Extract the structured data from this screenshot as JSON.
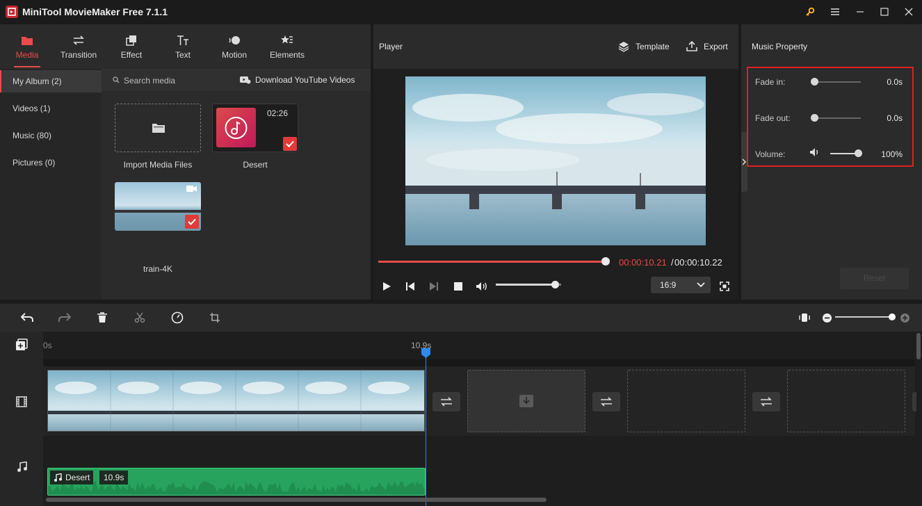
{
  "app": {
    "title": "MiniTool MovieMaker Free 7.1.1"
  },
  "toolbar": {
    "tabs": [
      {
        "label": "Media",
        "icon": "folder-icon",
        "active": true
      },
      {
        "label": "Transition",
        "icon": "swap-arrows-icon"
      },
      {
        "label": "Effect",
        "icon": "effect-icon"
      },
      {
        "label": "Text",
        "icon": "text-icon"
      },
      {
        "label": "Motion",
        "icon": "motion-icon"
      },
      {
        "label": "Elements",
        "icon": "elements-icon"
      }
    ]
  },
  "sidebar": {
    "items": [
      {
        "label": "My Album (2)",
        "active": true
      },
      {
        "label": "Videos (1)"
      },
      {
        "label": "Music (80)"
      },
      {
        "label": "Pictures (0)"
      }
    ]
  },
  "media": {
    "search_placeholder": "Search media",
    "download_label": "Download YouTube Videos",
    "cards": [
      {
        "label": "Import Media Files"
      },
      {
        "label": "Desert",
        "duration": "02:26",
        "checked": true
      },
      {
        "label": "train-4K",
        "checked": true
      }
    ]
  },
  "player": {
    "title": "Player",
    "template_label": "Template",
    "export_label": "Export",
    "time_current": "00:00:10.21",
    "time_separator": "/",
    "time_total": "00:00:10.22",
    "progress": 0.999,
    "volume": 0.9,
    "aspect_ratio": "16:9"
  },
  "music_property": {
    "title": "Music Property",
    "fade_in_label": "Fade in:",
    "fade_in_value": "0.0s",
    "fade_out_label": "Fade out:",
    "fade_out_value": "0.0s",
    "volume_label": "Volume:",
    "volume_value": "100%",
    "reset_label": "Reset"
  },
  "timeline": {
    "ruler_start": "0s",
    "ruler_mark": "10.9s",
    "audio_clip_name": "Desert",
    "audio_clip_duration": "10.9s"
  },
  "colors": {
    "accent": "#ea4a4a",
    "playhead": "#2b8bf0",
    "audio_clip": "#27a35e",
    "highlight_box": "#e02020"
  }
}
